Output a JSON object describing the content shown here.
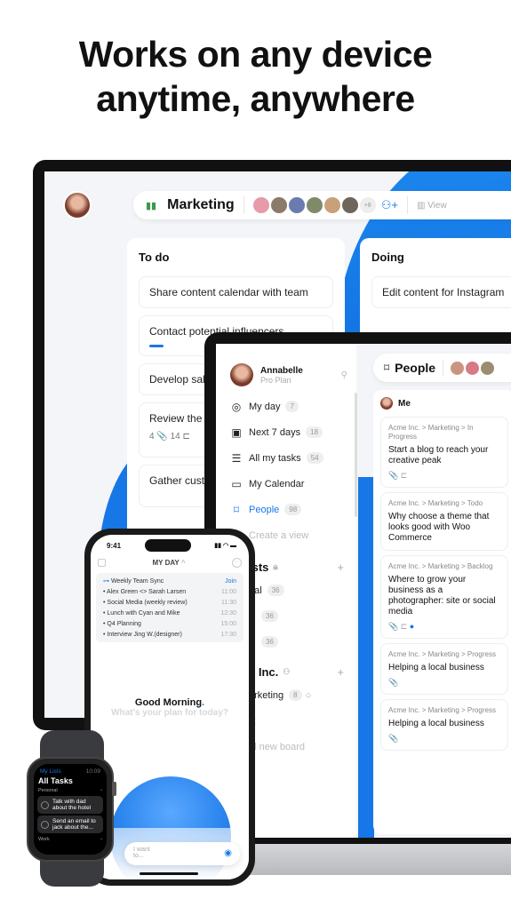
{
  "headline": {
    "line1": "Works on any device",
    "line2": "anytime, anywhere"
  },
  "monitor": {
    "board_title": "Marketing",
    "extra_members": "+8",
    "view_label": "View",
    "columns": [
      {
        "title": "To do",
        "cards": [
          {
            "text": "Share content calendar with team"
          },
          {
            "text": "Contact potential influencers"
          },
          {
            "text": "Develop sales"
          },
          {
            "text": "Review the c",
            "attachments": "4",
            "subtasks": "14"
          },
          {
            "text": "Gather customer new product"
          }
        ]
      },
      {
        "title": "Doing",
        "cards": [
          {
            "text": "Edit content for Instagram"
          }
        ]
      }
    ]
  },
  "laptop": {
    "user": {
      "name": "Annabelle",
      "plan": "Pro Plan"
    },
    "nav": [
      {
        "label": "My day",
        "count": "7",
        "icon": "target-icon"
      },
      {
        "label": "Next 7 days",
        "count": "18",
        "icon": "calendar-7-icon"
      },
      {
        "label": "All my tasks",
        "count": "54",
        "icon": "list-icon"
      },
      {
        "label": "My Calendar",
        "count": "",
        "icon": "calendar-icon"
      },
      {
        "label": "People",
        "count": "98",
        "icon": "bookmark-icon"
      }
    ],
    "create_view": "Create a view",
    "lists_title": "ists",
    "lists": [
      {
        "label": "nal",
        "count": "36"
      },
      {
        "label": "",
        "count": "36"
      },
      {
        "label": "",
        "count": "36"
      }
    ],
    "team_title": "e Inc.",
    "team_boards": [
      {
        "label": "arketing",
        "count": "8"
      },
      {
        "label": "R",
        "count": ""
      }
    ],
    "add_board": "ld new board",
    "view_title": "People",
    "group": "Me",
    "tasks": [
      {
        "path": "Acme Inc. > Marketing > In Progress",
        "title": "Start a blog to reach your creative peak"
      },
      {
        "path": "Acme Inc. > Marketing > Todo",
        "title": "Why choose a theme that looks good with Woo Commerce"
      },
      {
        "path": "Acme Inc. > Marketing > Backlog",
        "title": "Where to grow your business as a photographer: site or social media"
      },
      {
        "path": "Acme Inc. > Marketing > Progress",
        "title": "Helping a local business"
      },
      {
        "path": "Acme Inc. > Marketing > Progress",
        "title": "Helping a local business"
      }
    ]
  },
  "phone": {
    "time": "9:41",
    "title": "MY DAY",
    "events": [
      {
        "title": "Weekly Team Sync",
        "time": "Join"
      },
      {
        "title": "Alex Green <> Sarah Larsen",
        "time": "11:00"
      },
      {
        "title": "Social Media (weekly review)",
        "time": "11:30"
      },
      {
        "title": "Lunch with Cyan and Mike",
        "time": "12:30"
      },
      {
        "title": "Q4 Planning",
        "time": "15:00"
      },
      {
        "title": "Interview Jing W.(designer)",
        "time": "17:30"
      }
    ],
    "greeting": "Good Morning",
    "prompt": "What's your plan for today?",
    "input_placeholder": "I want to..."
  },
  "watch": {
    "header": "My Lists",
    "time": "10:09",
    "title": "All Tasks",
    "section1": "Personal",
    "tasks": [
      "Talk with dad about the hotel",
      "Send an email to jack about the..."
    ],
    "section2": "Work"
  },
  "colors": {
    "accent": "#1877e6",
    "bezel": "#111111"
  }
}
